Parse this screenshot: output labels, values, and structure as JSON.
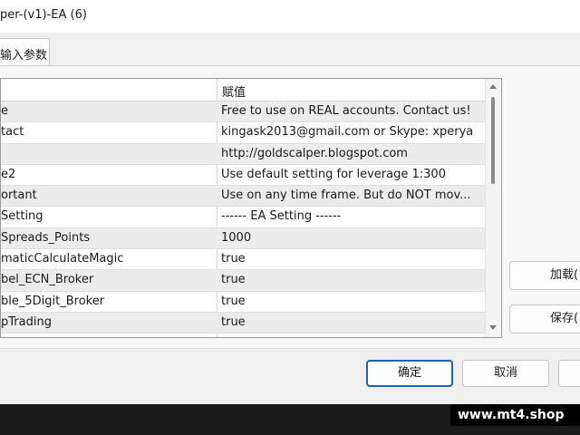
{
  "window": {
    "title": "per-(v1)-EA (6)"
  },
  "tabs": [
    {
      "label": "输入参数"
    }
  ],
  "table": {
    "headers": [
      "",
      "赋值"
    ],
    "rows": [
      {
        "name": "e",
        "value": "Free to use on REAL accounts. Contact us!"
      },
      {
        "name": "tact",
        "value": "kingask2013@gmail.com or Skype: xperya"
      },
      {
        "name": "",
        "value": "http://goldscalper.blogspot.com"
      },
      {
        "name": "e2",
        "value": "Use default setting for leverage 1:300"
      },
      {
        "name": "ortant",
        "value": "Use on any time frame. But do NOT mov..."
      },
      {
        "name": "Setting",
        "value": "------ EA Setting ------"
      },
      {
        "name": "Spreads_Points",
        "value": "1000"
      },
      {
        "name": "maticCalculateMagic",
        "value": "true"
      },
      {
        "name": "bel_ECN_Broker",
        "value": "true"
      },
      {
        "name": "ble_5Digit_Broker",
        "value": "true"
      },
      {
        "name": "pTrading",
        "value": "true"
      }
    ]
  },
  "side_buttons": {
    "load": "加载(",
    "save": "保存("
  },
  "footer_buttons": {
    "ok": "确定",
    "cancel": "取消"
  },
  "watermark": "www.mt4.shop"
}
